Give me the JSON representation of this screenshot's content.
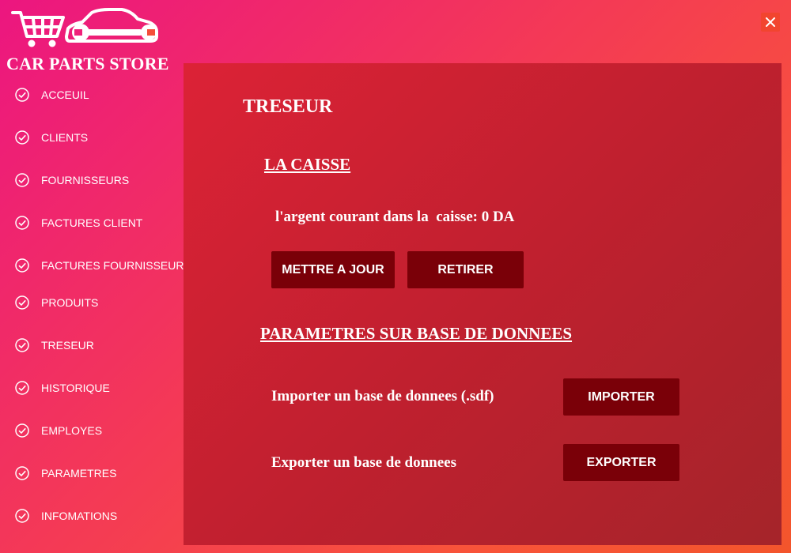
{
  "app": {
    "title": "CAR PARTS STORE"
  },
  "sidebar": {
    "items": [
      {
        "label": "ACCEUIL"
      },
      {
        "label": "CLIENTS"
      },
      {
        "label": "FOURNISSEURS"
      },
      {
        "label": "FACTURES CLIENT"
      },
      {
        "label": "FACTURES FOURNISSEUR"
      },
      {
        "label": "PRODUITS"
      },
      {
        "label": "TRESEUR"
      },
      {
        "label": "HISTORIQUE"
      },
      {
        "label": "EMPLOYES"
      },
      {
        "label": "PARAMETRES"
      },
      {
        "label": "INFOMATIONS"
      }
    ]
  },
  "main": {
    "title": "TRESEUR",
    "caisse": {
      "title": "LA CAISSE",
      "current_money_text": "l'argent courant dans la  caisse: 0 DA",
      "update_label": "METTRE A JOUR",
      "withdraw_label": "RETIRER"
    },
    "database": {
      "title": "PARAMETRES SUR BASE DE DONNEES",
      "import_text": "Importer un base de donnees (.sdf)",
      "import_label": "IMPORTER",
      "export_text": "Exporter un base de donnees",
      "export_label": "EXPORTER"
    }
  },
  "icons": {
    "logo": "cart-car-wrench-logo",
    "nav": "check-circle-icon",
    "close": "close-icon"
  },
  "colors": {
    "gradient_start": "#ec1680",
    "gradient_end": "#f3552c",
    "panel": "#c0202f",
    "button": "#7a0008",
    "close_bg": "#f2452f"
  }
}
